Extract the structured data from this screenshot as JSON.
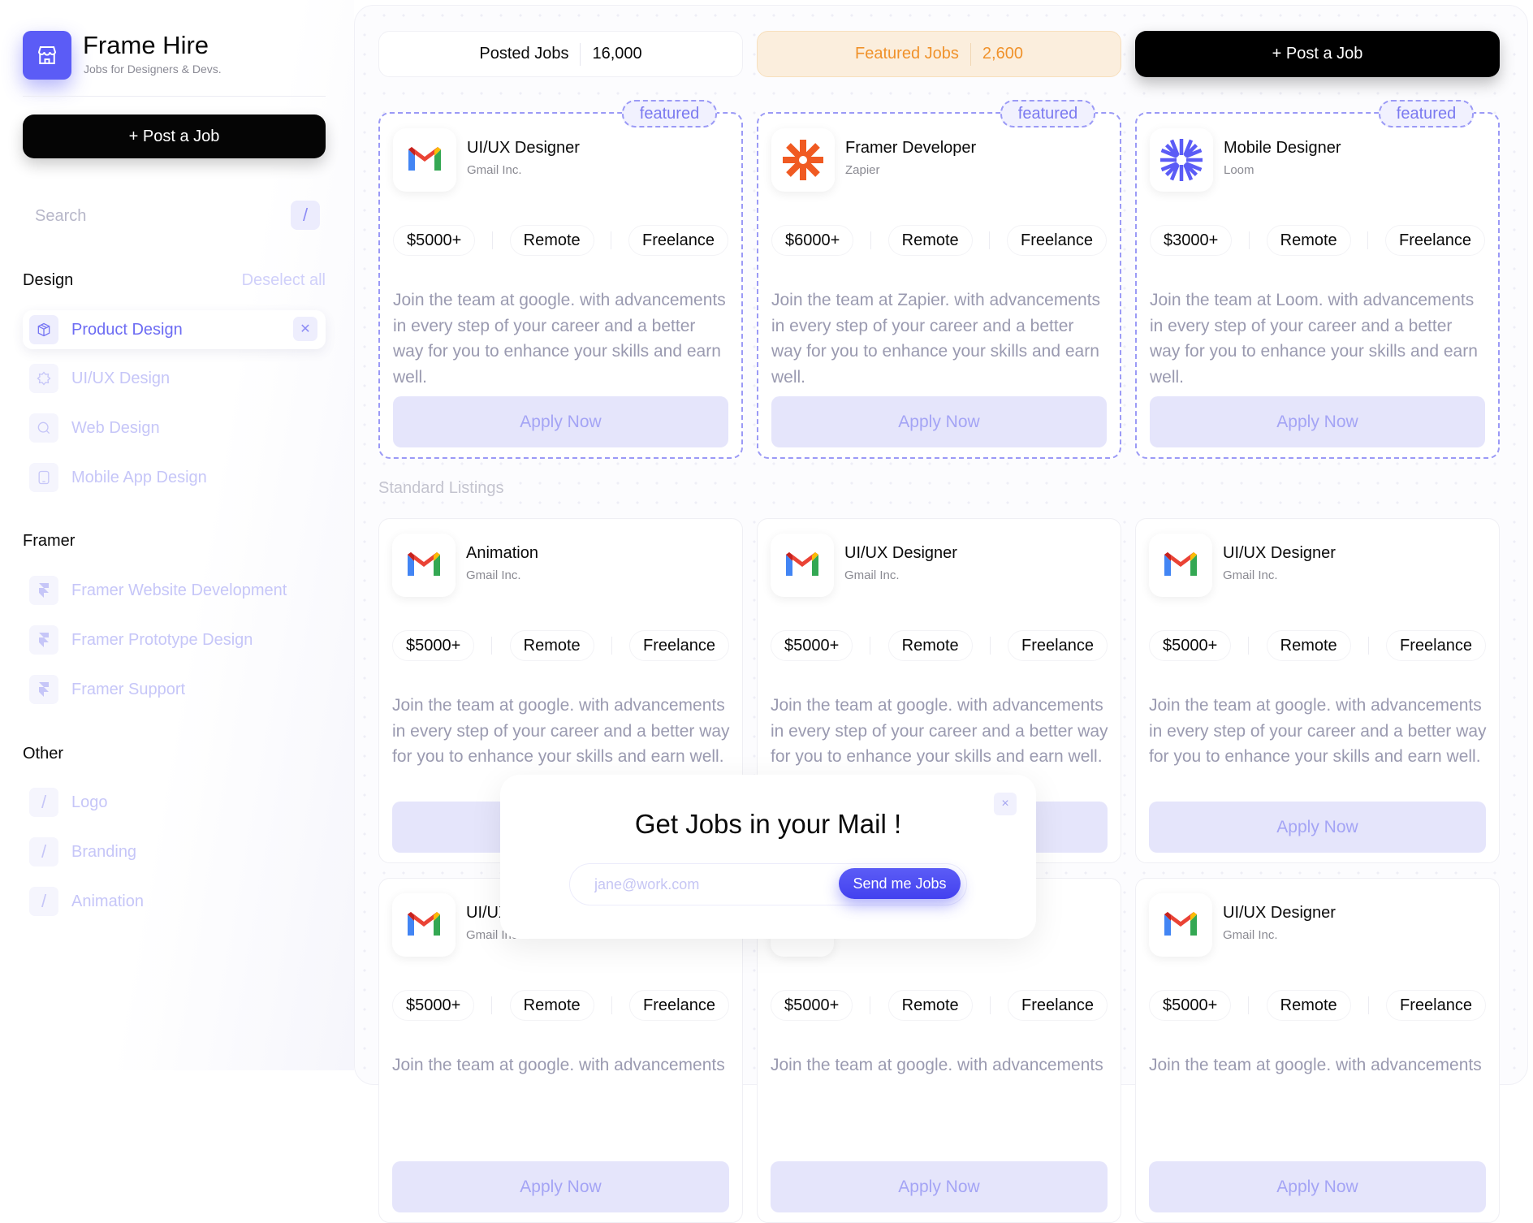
{
  "brand": {
    "title": "Frame Hire",
    "subtitle": "Jobs for Designers & Devs."
  },
  "sidebar": {
    "post_label": "+ Post a Job",
    "search_placeholder": "Search",
    "search_shortcut": "/",
    "sections": [
      {
        "title": "Design",
        "action": "Deselect all",
        "items": [
          {
            "label": "Product Design",
            "icon": "box-icon",
            "active": true
          },
          {
            "label": "UI/UX Design",
            "icon": "badge-icon"
          },
          {
            "label": "Web Design",
            "icon": "search-icon"
          },
          {
            "label": "Mobile App Design",
            "icon": "mobile-icon"
          }
        ]
      },
      {
        "title": "Framer",
        "items": [
          {
            "label": "Framer Website Development",
            "icon": "framer-icon"
          },
          {
            "label": "Framer Prototype Design",
            "icon": "framer-icon"
          },
          {
            "label": "Framer Support",
            "icon": "framer-icon"
          }
        ]
      },
      {
        "title": "Other",
        "items": [
          {
            "label": "Logo",
            "icon": "slash-icon"
          },
          {
            "label": "Branding",
            "icon": "slash-icon"
          },
          {
            "label": "Animation",
            "icon": "slash-icon"
          }
        ]
      }
    ]
  },
  "stats": {
    "posted_label": "Posted Jobs",
    "posted_value": "16,000",
    "featured_label": "Featured Jobs",
    "featured_value": "2,600",
    "post_label": "+ Post a Job"
  },
  "colors": {
    "accent": "#5b5cf6",
    "featured_orange": "#f0922b"
  },
  "featured_badge": "featured",
  "apply_label": "Apply Now",
  "standard_label": "Standard Listings",
  "featured": [
    {
      "title": "UI/UX Designer",
      "company": "Gmail Inc.",
      "logo": "gmail-icon",
      "tags": [
        "$5000+",
        "Remote",
        "Freelance"
      ],
      "desc": "Join the team at google. with advancements in every step of your career and a better way for you to enhance your skills and earn well."
    },
    {
      "title": "Framer Developer",
      "company": "Zapier",
      "logo": "zapier-icon",
      "tags": [
        "$6000+",
        "Remote",
        "Freelance"
      ],
      "desc": "Join the team at Zapier. with advancements in every step of your career and a better way for you to enhance your skills and earn well."
    },
    {
      "title": "Mobile Designer",
      "company": "Loom",
      "logo": "loom-icon",
      "tags": [
        "$3000+",
        "Remote",
        "Freelance"
      ],
      "desc": "Join the team at Loom. with advancements  in every step of your career and a better way for you to enhance your skills and earn well."
    }
  ],
  "standard": [
    {
      "title": "Animation",
      "company": "Gmail Inc.",
      "logo": "gmail-icon",
      "tags": [
        "$5000+",
        "Remote",
        "Freelance"
      ],
      "desc": "Join the team at google. with advancements in every step of your career and a better way for you to enhance your skills and earn well."
    },
    {
      "title": "UI/UX Designer",
      "company": "Gmail Inc.",
      "logo": "gmail-icon",
      "tags": [
        "$5000+",
        "Remote",
        "Freelance"
      ],
      "desc": "Join the team at google. with advancements in every step of your career and a better way for you to enhance your skills and earn well."
    },
    {
      "title": "UI/UX Designer",
      "company": "Gmail Inc.",
      "logo": "gmail-icon",
      "tags": [
        "$5000+",
        "Remote",
        "Freelance"
      ],
      "desc": "Join the team at google. with advancements in every step of your career and a better way for you to enhance your skills and earn well."
    },
    {
      "title": "UI/UX Designer",
      "company": "Gmail Inc.",
      "logo": "gmail-icon",
      "tags": [
        "$5000+",
        "Remote",
        "Freelance"
      ],
      "desc": "Join the team at google. with advancements"
    },
    {
      "title": "",
      "company": "",
      "logo": "gmail-icon",
      "tags": [
        "$5000+",
        "Remote",
        "Freelance"
      ],
      "desc": "Join the team at google. with advancements"
    },
    {
      "title": "UI/UX Designer",
      "company": "Gmail Inc.",
      "logo": "gmail-icon",
      "tags": [
        "$5000+",
        "Remote",
        "Freelance"
      ],
      "desc": "Join the team at google. with advancements"
    }
  ],
  "popup": {
    "title": "Get Jobs in your Mail !",
    "email_placeholder": "jane@work.com",
    "email_value": "",
    "send_label": "Send me Jobs",
    "close": "×"
  }
}
